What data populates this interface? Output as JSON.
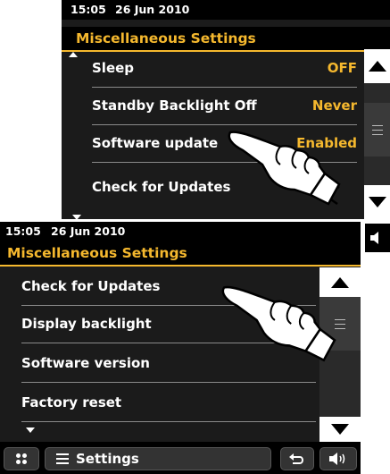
{
  "back_screen": {
    "status": {
      "time": "15:05",
      "date": "26 Jun 2010"
    },
    "title": "Miscellaneous Settings",
    "items": [
      {
        "label": "Sleep",
        "value": "OFF"
      },
      {
        "label": "Standby Backlight Off",
        "value": "Never"
      },
      {
        "label": "Software update",
        "value": "Enabled"
      },
      {
        "label": "Check for Updates",
        "value": ""
      }
    ]
  },
  "front_screen": {
    "status": {
      "time": "15:05",
      "date": "26 Jun 2010"
    },
    "title": "Miscellaneous Settings",
    "items": [
      {
        "label": "Check for Updates"
      },
      {
        "label": "Display backlight"
      },
      {
        "label": "Software version"
      },
      {
        "label": "Factory reset"
      }
    ],
    "bottom": {
      "settings_label": "Settings"
    }
  },
  "colors": {
    "accent": "#f5b82e",
    "screen_bg": "#1b1b1b"
  },
  "icons": [
    "scroll-up-icon",
    "scroll-down-icon",
    "scroll-handle-icon",
    "menu-grid-icon",
    "list-icon",
    "back-arrow-icon",
    "volume-icon",
    "pointing-hand-icon"
  ]
}
